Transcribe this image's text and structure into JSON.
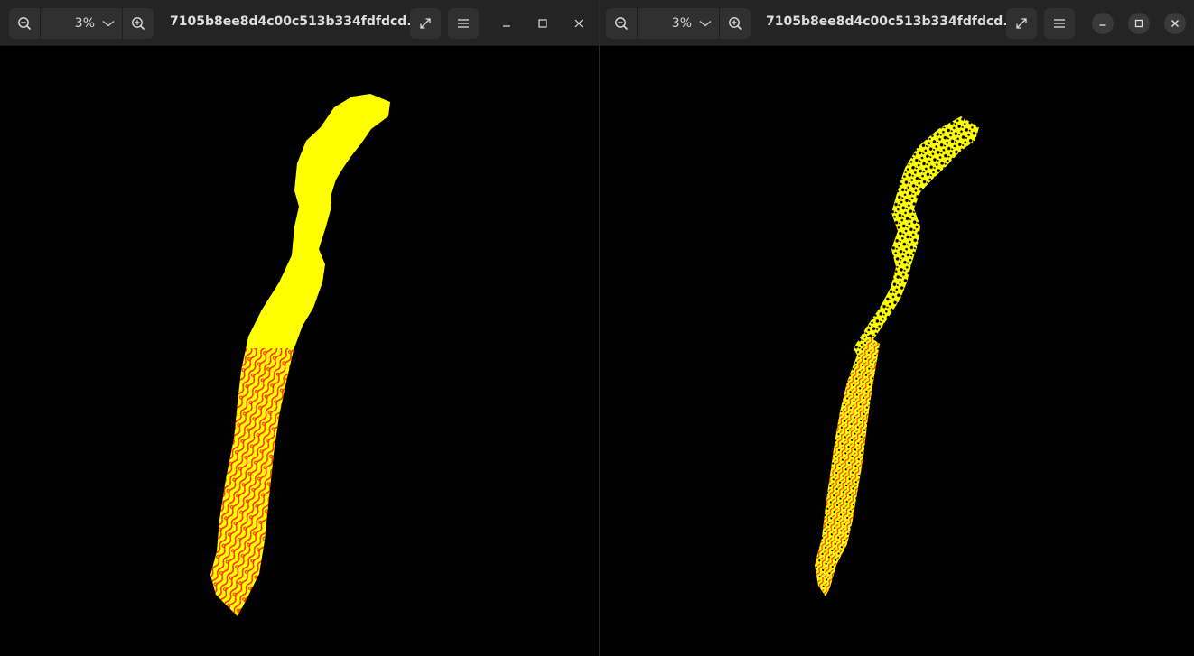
{
  "viewers": [
    {
      "zoom": "3%",
      "title": "7105b8ee8d4c00c513b334fdfdcd...",
      "icons": {
        "zoom_out": "zoom-out-icon",
        "zoom_menu": "chevron-down-icon",
        "zoom_in": "zoom-in-icon",
        "fullscreen": "expand-icon",
        "menu": "hamburger-menu-icon",
        "minimize": "minimize-icon",
        "maximize": "maximize-icon",
        "close": "close-icon"
      }
    },
    {
      "zoom": "3%",
      "title": "7105b8ee8d4c00c513b334fdfdcd...",
      "icons": {
        "zoom_out": "zoom-out-icon",
        "zoom_menu": "chevron-down-icon",
        "zoom_in": "zoom-in-icon",
        "fullscreen": "expand-icon",
        "menu": "hamburger-menu-icon",
        "minimize": "minimize-icon",
        "maximize": "maximize-icon",
        "close": "close-icon"
      }
    }
  ],
  "colors": {
    "background": "#000000",
    "headerbar": "#242424",
    "mask_fill": "#ffff00",
    "mask_edges": "#ff2a00"
  }
}
